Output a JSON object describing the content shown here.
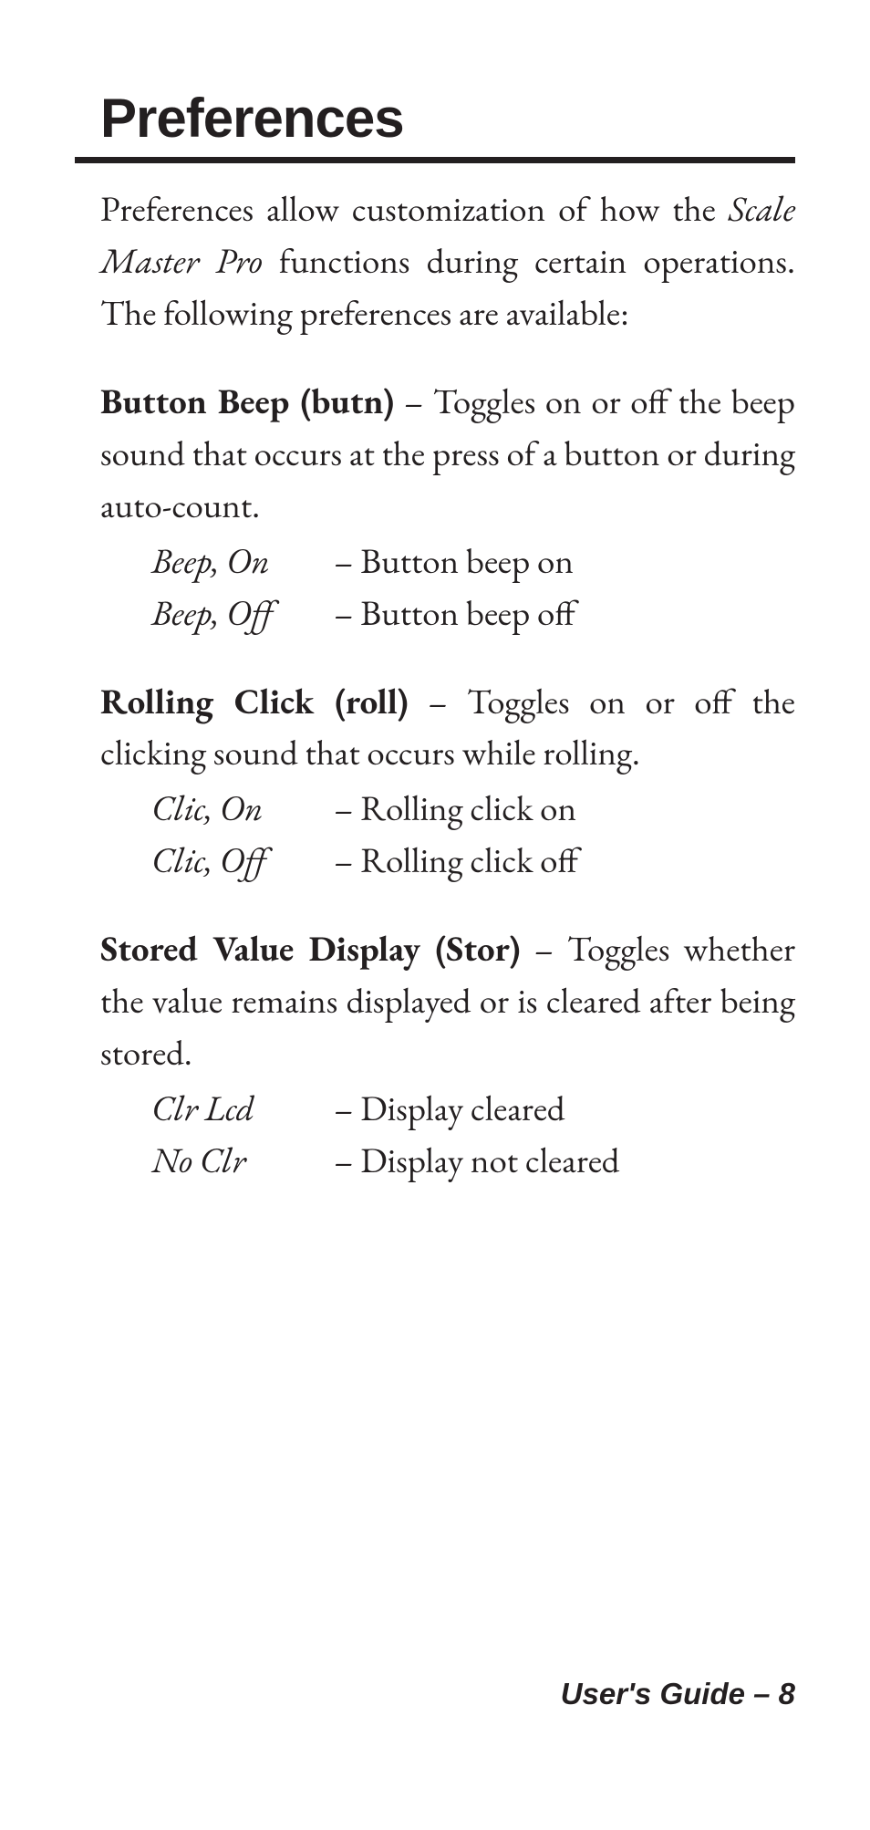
{
  "heading": "Preferences",
  "intro": {
    "before": "Preferences allow customization of how the ",
    "product": "Scale Master Pro",
    "after": " functions during certain operations. The following preferences are available:"
  },
  "sections": [
    {
      "title": "Button Beep (butn)",
      "desc": " – Toggles on or off the beep sound that occurs at the press of a button or during auto-count.",
      "options": [
        {
          "name": "Beep, On",
          "desc": "– Button beep on"
        },
        {
          "name": "Beep, Off",
          "desc": "– Button beep off"
        }
      ]
    },
    {
      "title": "Rolling Click (roll)",
      "desc": " – Toggles on or off the clicking sound that occurs while rolling.",
      "options": [
        {
          "name": "Clic, On",
          "desc": "– Rolling click on"
        },
        {
          "name": "Clic, Off",
          "desc": "– Rolling click off"
        }
      ]
    },
    {
      "title": "Stored Value Display (Stor)",
      "desc": " – Toggles whether the value remains displayed or is cleared after being stored.",
      "options": [
        {
          "name": "Clr Lcd",
          "desc": "– Display cleared"
        },
        {
          "name": "No Clr",
          "desc": "– Display not cleared"
        }
      ]
    }
  ],
  "footer": "User's Guide – 8"
}
